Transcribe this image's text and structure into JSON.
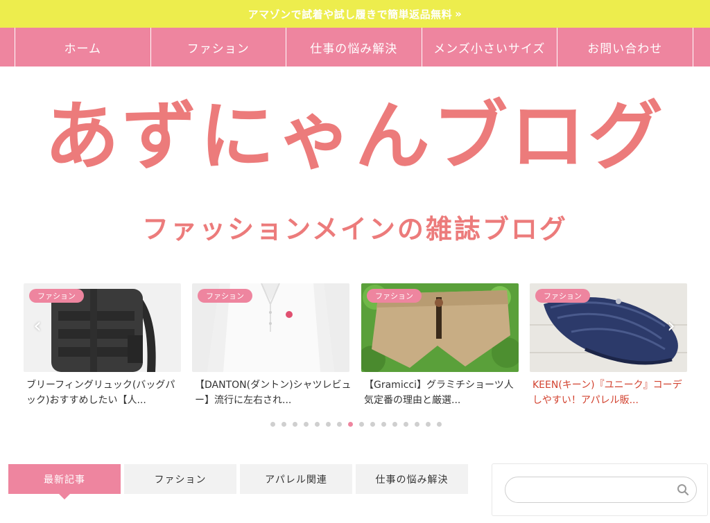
{
  "topbar": {
    "text": "アマゾンで試着や試し履きで簡単返品無料",
    "chevron": "»"
  },
  "nav": {
    "items": [
      "ホーム",
      "ファション",
      "仕事の悩み解決",
      "メンズ小さいサイズ",
      "お問い合わせ"
    ]
  },
  "logo": {
    "title": "あずにゃんブログ",
    "tagline": "ファッションメインの雑誌ブログ"
  },
  "carousel": {
    "prev": "‹",
    "next": "›",
    "cards": [
      {
        "badge": "ファション",
        "title": "ブリーフィングリュック(バッグパック)おすすめしたい【人...",
        "image": "black-backpack"
      },
      {
        "badge": "ファション",
        "title": "【DANTON(ダントン)シャツレビュー】流行に左右され...",
        "image": "white-shirt"
      },
      {
        "badge": "ファション",
        "title": "【Gramicci】グラミチショーツ人気定番の理由と厳選...",
        "image": "beige-shorts"
      },
      {
        "badge": "ファション",
        "title": "KEEN(キーン)『ユニーク』コーデしやすい！アパレル販...",
        "image": "navy-sandal"
      }
    ],
    "dots_count": 16,
    "active_dot": 7
  },
  "tabs": [
    "最新記事",
    "ファション",
    "アパレル関連",
    "仕事の悩み解決"
  ],
  "search": {
    "placeholder": ""
  },
  "colors": {
    "accent": "#ee859f",
    "topbar": "#eded4d",
    "logo": "#ec7b7b",
    "link_red": "#d2422f"
  }
}
